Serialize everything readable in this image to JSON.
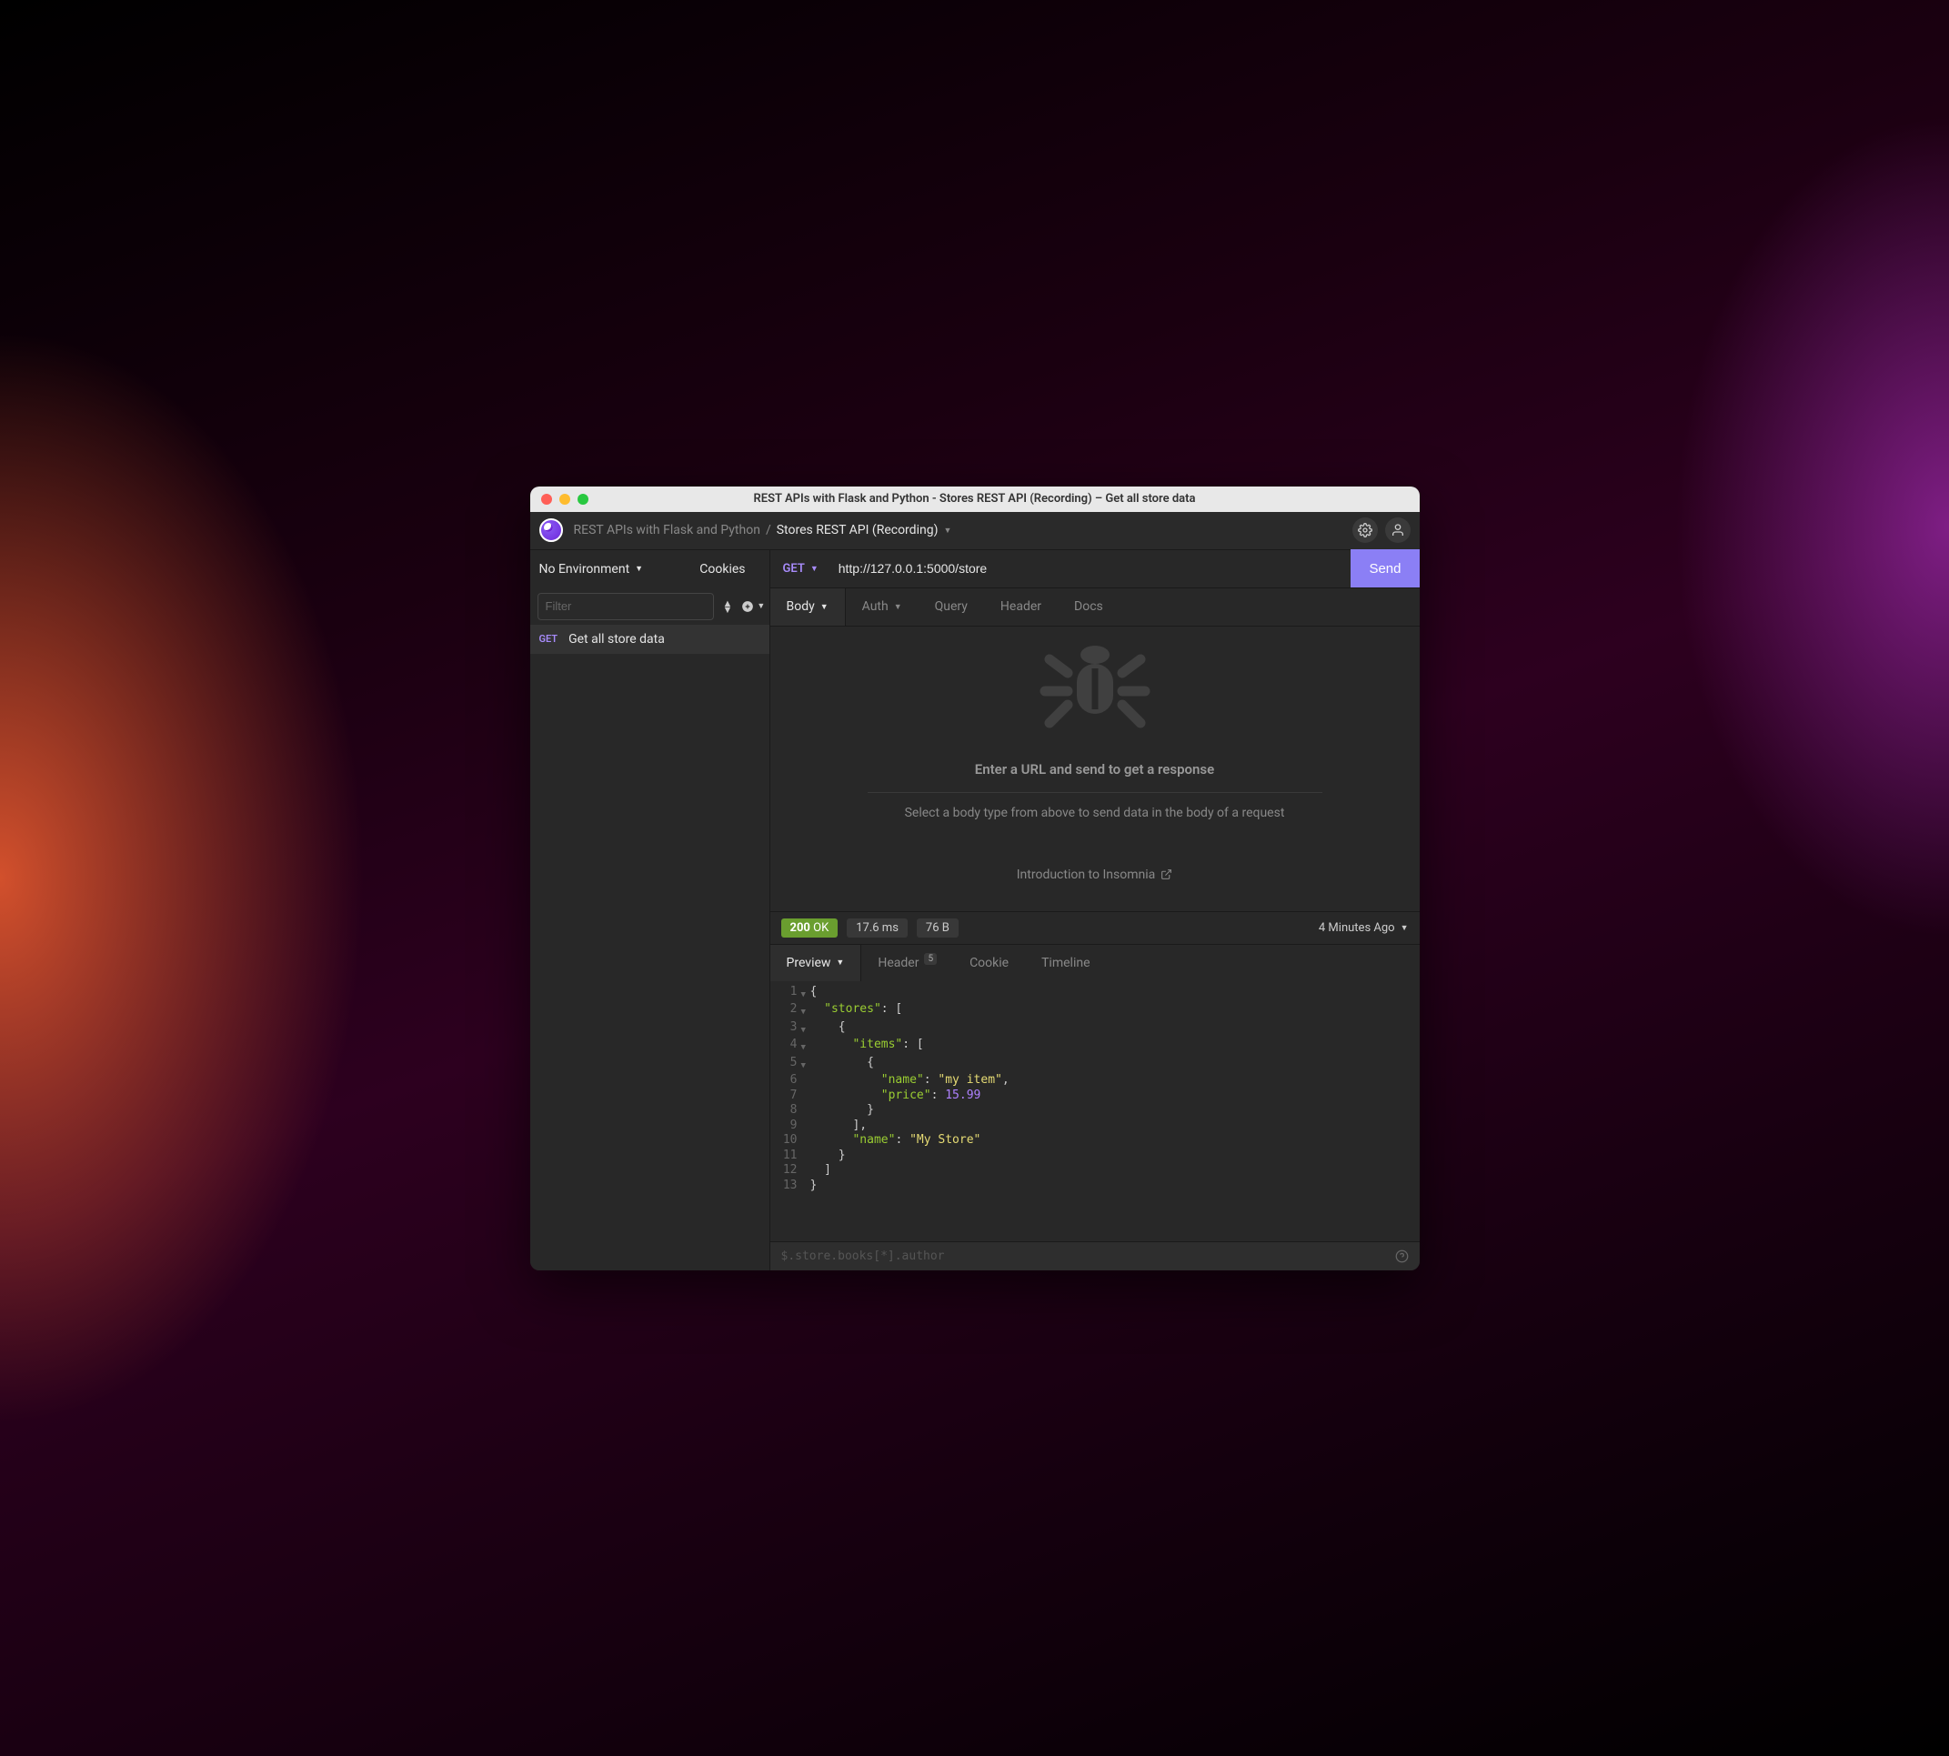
{
  "window": {
    "title": "REST APIs with Flask and Python - Stores REST API (Recording) – Get all store data"
  },
  "breadcrumb": {
    "project": "REST APIs with Flask and Python",
    "separator": "/",
    "collection": "Stores REST API (Recording)"
  },
  "sidebar": {
    "environment": "No Environment",
    "cookies": "Cookies",
    "filter_placeholder": "Filter",
    "requests": [
      {
        "method": "GET",
        "name": "Get all store data"
      }
    ]
  },
  "request": {
    "method": "GET",
    "url": "http://127.0.0.1:5000/store",
    "send": "Send",
    "tabs": {
      "body": "Body",
      "auth": "Auth",
      "query": "Query",
      "header": "Header",
      "docs": "Docs"
    },
    "empty": {
      "title": "Enter a URL and send to get a response",
      "subtitle": "Select a body type from above to send data in the body of a request",
      "intro": "Introduction to Insomnia"
    }
  },
  "response": {
    "status_code": "200",
    "status_text": "OK",
    "time": "17.6 ms",
    "size": "76 B",
    "age": "4 Minutes Ago",
    "tabs": {
      "preview": "Preview",
      "header": "Header",
      "header_count": "5",
      "cookie": "Cookie",
      "timeline": "Timeline"
    },
    "json_lines": [
      {
        "n": 1,
        "fold": true,
        "tokens": [
          [
            "p",
            "{"
          ]
        ]
      },
      {
        "n": 2,
        "fold": true,
        "tokens": [
          [
            "p",
            "  "
          ],
          [
            "k",
            "\"stores\""
          ],
          [
            "p",
            ": ["
          ]
        ]
      },
      {
        "n": 3,
        "fold": true,
        "tokens": [
          [
            "p",
            "    {"
          ]
        ]
      },
      {
        "n": 4,
        "fold": true,
        "tokens": [
          [
            "p",
            "      "
          ],
          [
            "k",
            "\"items\""
          ],
          [
            "p",
            ": ["
          ]
        ]
      },
      {
        "n": 5,
        "fold": true,
        "tokens": [
          [
            "p",
            "        {"
          ]
        ]
      },
      {
        "n": 6,
        "fold": false,
        "tokens": [
          [
            "p",
            "          "
          ],
          [
            "k",
            "\"name\""
          ],
          [
            "p",
            ": "
          ],
          [
            "s",
            "\"my item\""
          ],
          [
            "p",
            ","
          ]
        ]
      },
      {
        "n": 7,
        "fold": false,
        "tokens": [
          [
            "p",
            "          "
          ],
          [
            "k",
            "\"price\""
          ],
          [
            "p",
            ": "
          ],
          [
            "n",
            "15.99"
          ]
        ]
      },
      {
        "n": 8,
        "fold": false,
        "tokens": [
          [
            "p",
            "        }"
          ]
        ]
      },
      {
        "n": 9,
        "fold": false,
        "tokens": [
          [
            "p",
            "      ],"
          ]
        ]
      },
      {
        "n": 10,
        "fold": false,
        "tokens": [
          [
            "p",
            "      "
          ],
          [
            "k",
            "\"name\""
          ],
          [
            "p",
            ": "
          ],
          [
            "s",
            "\"My Store\""
          ]
        ]
      },
      {
        "n": 11,
        "fold": false,
        "tokens": [
          [
            "p",
            "    }"
          ]
        ]
      },
      {
        "n": 12,
        "fold": false,
        "tokens": [
          [
            "p",
            "  ]"
          ]
        ]
      },
      {
        "n": 13,
        "fold": false,
        "tokens": [
          [
            "p",
            "}"
          ]
        ]
      }
    ],
    "jsonpath_placeholder": "$.store.books[*].author"
  }
}
